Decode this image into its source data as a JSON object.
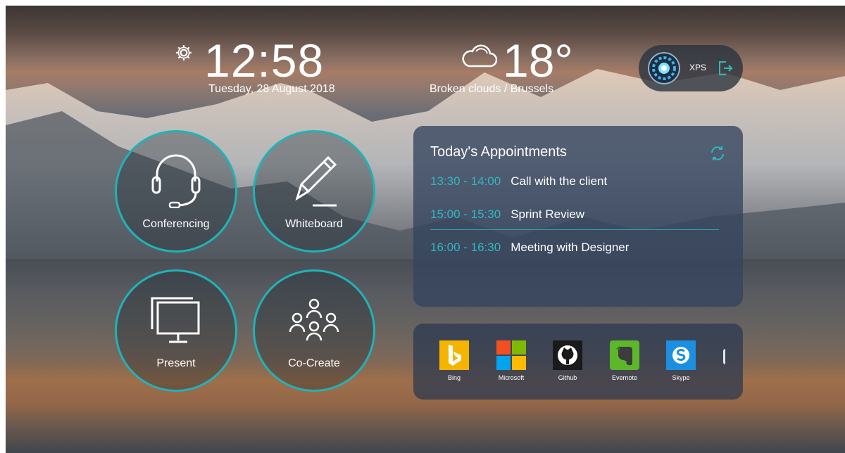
{
  "clock": {
    "time": "12:58",
    "date": "Tuesday, 28 August 2018",
    "icon": "gear-icon"
  },
  "weather": {
    "temperature": "18°",
    "condition": "Broken clouds / Brussels",
    "icon": "cloud-icon"
  },
  "user": {
    "name": "XPS",
    "avatar": "avatar",
    "logout_icon": "logout-icon"
  },
  "tiles": [
    {
      "label": "Conferencing",
      "icon": "headset-icon"
    },
    {
      "label": "Whiteboard",
      "icon": "pencil-icon"
    },
    {
      "label": "Present",
      "icon": "monitor-icon"
    },
    {
      "label": "Co-Create",
      "icon": "people-icon"
    }
  ],
  "appointments": {
    "title": "Today's Appointments",
    "items": [
      {
        "time": "13:30 - 14:00",
        "title": "Call with the client"
      },
      {
        "time": "15:00 - 15:30",
        "title": "Sprint Review"
      },
      {
        "time": "16:00 - 16:30",
        "title": "Meeting with Designer"
      }
    ]
  },
  "apps": [
    {
      "label": "Bing",
      "icon": "bing-icon"
    },
    {
      "label": "Microsoft",
      "icon": "microsoft-icon"
    },
    {
      "label": "Github",
      "icon": "github-icon"
    },
    {
      "label": "Evernote",
      "icon": "evernote-icon"
    },
    {
      "label": "Skype",
      "icon": "skype-icon"
    }
  ],
  "colors": {
    "accent": "#1fb3b8",
    "time_accent": "#2fb8c0",
    "panel": "#34445e"
  }
}
